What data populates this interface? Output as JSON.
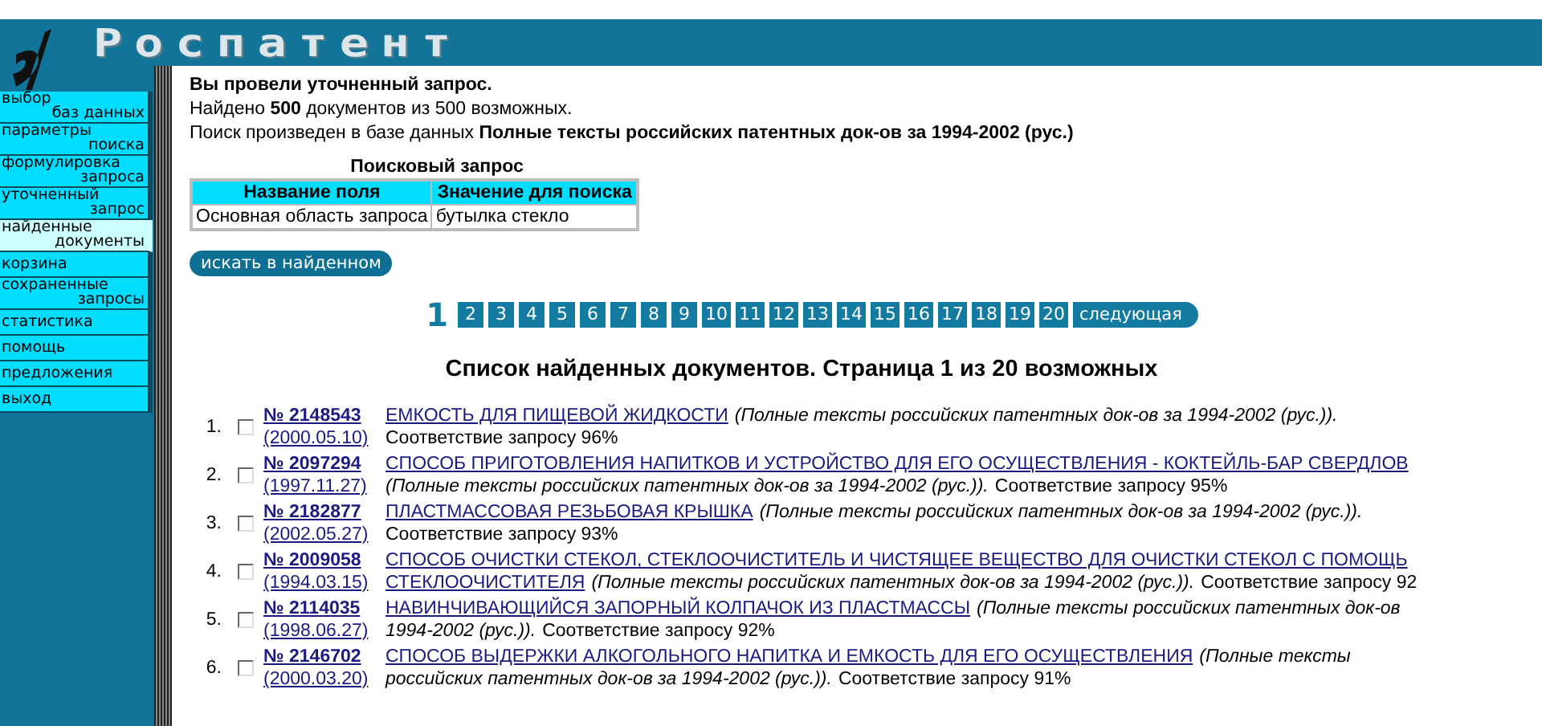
{
  "logo": {
    "text": "Роспатент"
  },
  "sidebar": {
    "items": [
      {
        "lines": [
          "выбор",
          "баз данных"
        ],
        "selected": false
      },
      {
        "lines": [
          "параметры",
          "поиска"
        ],
        "selected": false
      },
      {
        "lines": [
          "формулировка",
          "запроса"
        ],
        "selected": false
      },
      {
        "lines": [
          "уточненный",
          "запрос"
        ],
        "selected": false
      },
      {
        "lines": [
          "найденные",
          "документы"
        ],
        "selected": true
      },
      {
        "lines": [
          "корзина"
        ],
        "selected": false
      },
      {
        "lines": [
          "сохраненные",
          "запросы"
        ],
        "selected": false
      },
      {
        "lines": [
          "статистика"
        ],
        "selected": false
      },
      {
        "lines": [
          "помощь"
        ],
        "selected": false
      },
      {
        "lines": [
          "предложения"
        ],
        "selected": false
      },
      {
        "lines": [
          "выход"
        ],
        "selected": false
      }
    ]
  },
  "summary": {
    "title": "Вы провели уточненный запрос.",
    "found": "Найдено **500** документов из 500 возможных.",
    "database": "Поиск произведен в базе данных **Полные тексты российских патентных док-ов за 1994-2002 (рус.)**"
  },
  "query_table": {
    "caption": "Поисковый запрос",
    "columns": [
      "Название поля",
      "Значение для поиска"
    ],
    "rows": [
      [
        "Основная область запроса",
        "бутылка стекло"
      ]
    ]
  },
  "search_in_results_button": "искать в найденном",
  "pagination": {
    "pages": [
      {
        "label": "1",
        "selected": true
      },
      {
        "label": "2",
        "selected": false
      },
      {
        "label": "3",
        "selected": false
      },
      {
        "label": "4",
        "selected": false
      },
      {
        "label": "5",
        "selected": false
      },
      {
        "label": "6",
        "selected": false
      },
      {
        "label": "7",
        "selected": false
      },
      {
        "label": "8",
        "selected": false
      },
      {
        "label": "9",
        "selected": false
      },
      {
        "label": "10",
        "selected": false
      },
      {
        "label": "11",
        "selected": false
      },
      {
        "label": "12",
        "selected": false
      },
      {
        "label": "13",
        "selected": false
      },
      {
        "label": "14",
        "selected": false
      },
      {
        "label": "15",
        "selected": false
      },
      {
        "label": "16",
        "selected": false
      },
      {
        "label": "17",
        "selected": false
      },
      {
        "label": "18",
        "selected": false
      },
      {
        "label": "19",
        "selected": false
      },
      {
        "label": "20",
        "selected": false
      }
    ],
    "next": "следующая"
  },
  "results_heading": "Список найденных документов. Страница 1 из 20 возможных",
  "results": [
    {
      "index": "1.",
      "checked": false,
      "patent": "№ 2148543",
      "date": "(2000.05.10)",
      "lines": [
        [
          {
            "kind": "title",
            "text": "ЕМКОСТЬ ДЛЯ ПИЩЕВОЙ ЖИДКОСТИ"
          },
          {
            "kind": "source",
            "text": "(Полные тексты российских патентных док-ов за 1994-2002 (рус.))."
          }
        ],
        [
          {
            "kind": "match",
            "text": "Соответствие запросу 96%"
          }
        ]
      ]
    },
    {
      "index": "2.",
      "checked": false,
      "patent": "№ 2097294",
      "date": "(1997.11.27)",
      "lines": [
        [
          {
            "kind": "title",
            "text": "СПОСОБ ПРИГОТОВЛЕНИЯ НАПИТКОВ И УСТРОЙСТВО ДЛЯ ЕГО ОСУЩЕСТВЛЕНИЯ - КОКТЕЙЛЬ-БАР СВЕРДЛОВ"
          }
        ],
        [
          {
            "kind": "source",
            "text": "(Полные тексты российских патентных док-ов за 1994-2002 (рус.))."
          },
          {
            "kind": "match",
            "text": "Соответствие запросу 95%"
          }
        ]
      ]
    },
    {
      "index": "3.",
      "checked": false,
      "patent": "№ 2182877",
      "date": "(2002.05.27)",
      "lines": [
        [
          {
            "kind": "title",
            "text": "ПЛАСТМАССОВАЯ РЕЗЬБОВАЯ КРЫШКА"
          },
          {
            "kind": "source",
            "text": "(Полные тексты российских патентных док-ов за 1994-2002 (рус.))."
          }
        ],
        [
          {
            "kind": "match",
            "text": "Соответствие запросу 93%"
          }
        ]
      ]
    },
    {
      "index": "4.",
      "checked": false,
      "patent": "№ 2009058",
      "date": "(1994.03.15)",
      "lines": [
        [
          {
            "kind": "title",
            "text": "СПОСОБ ОЧИСТКИ СТЕКОЛ, СТЕКЛООЧИСТИТЕЛЬ И ЧИСТЯЩЕЕ ВЕЩЕСТВО ДЛЯ ОЧИСТКИ СТЕКОЛ С ПОМОЩЬ"
          }
        ],
        [
          {
            "kind": "title",
            "text": "СТЕКЛООЧИСТИТЕЛЯ"
          },
          {
            "kind": "source",
            "text": "(Полные тексты российских патентных док-ов за 1994-2002 (рус.))."
          },
          {
            "kind": "match",
            "text": "Соответствие запросу 92"
          }
        ]
      ]
    },
    {
      "index": "5.",
      "checked": false,
      "patent": "№ 2114035",
      "date": "(1998.06.27)",
      "lines": [
        [
          {
            "kind": "title",
            "text": "НАВИНЧИВАЮЩИЙСЯ ЗАПОРНЫЙ КОЛПАЧОК ИЗ ПЛАСТМАССЫ"
          },
          {
            "kind": "source",
            "text": "(Полные тексты российских патентных док-ов"
          }
        ],
        [
          {
            "kind": "source",
            "text": "1994-2002 (рус.))."
          },
          {
            "kind": "match",
            "text": "Соответствие запросу 92%"
          }
        ]
      ]
    },
    {
      "index": "6.",
      "checked": false,
      "patent": "№ 2146702",
      "date": "(2000.03.20)",
      "lines": [
        [
          {
            "kind": "title",
            "text": "СПОСОБ ВЫДЕРЖКИ АЛКОГОЛЬНОГО НАПИТКА И ЕМКОСТЬ ДЛЯ ЕГО ОСУЩЕСТВЛЕНИЯ"
          },
          {
            "kind": "source",
            "text": "(Полные тексты"
          }
        ],
        [
          {
            "kind": "source",
            "text": "российских патентных док-ов за 1994-2002 (рус.))."
          },
          {
            "kind": "match",
            "text": "Соответствие запросу 91%"
          }
        ]
      ]
    }
  ]
}
